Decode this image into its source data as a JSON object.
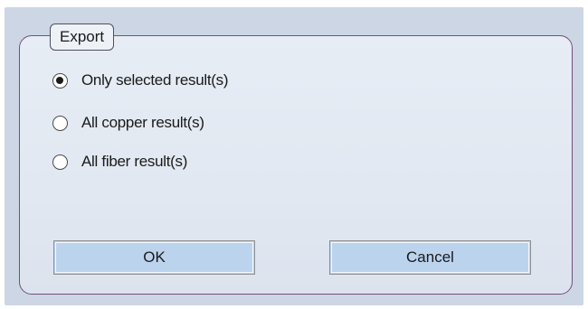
{
  "dialog": {
    "group_title": "Export",
    "options": [
      {
        "label": "Only selected result(s)",
        "selected": true
      },
      {
        "label": "All copper result(s)",
        "selected": false
      },
      {
        "label": "All fiber result(s)",
        "selected": false
      }
    ],
    "ok_label": "OK",
    "cancel_label": "Cancel"
  },
  "colors": {
    "window_background": "#ccd6e4",
    "group_border": "#74507c",
    "button_fill": "#bcd3ee"
  }
}
